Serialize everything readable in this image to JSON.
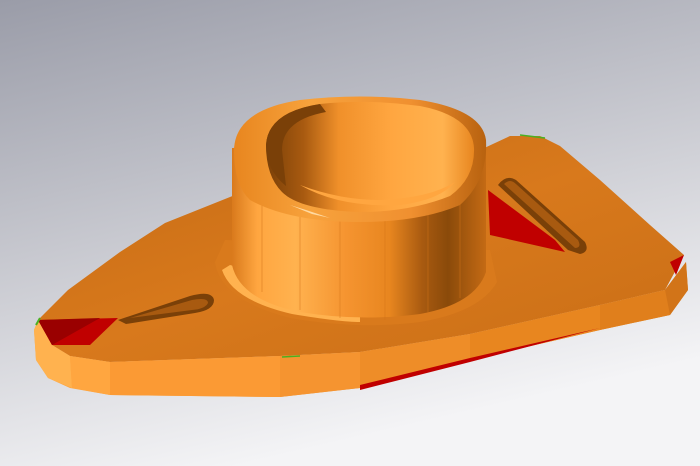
{
  "viewport": {
    "background_top": "#9a9ca8",
    "background_bottom": "#f4f4f6"
  },
  "model": {
    "name_icon": "flange-bushing-3d-model",
    "colors": {
      "face_main": "#f0902a",
      "face_light": "#ffa640",
      "face_highlight": "#ffd9a0",
      "face_dark": "#a85a10",
      "face_shadow": "#7a4008",
      "face_mid": "#d97a1c",
      "cut_section": "#c00000",
      "edge_green": "#4caf20"
    }
  }
}
